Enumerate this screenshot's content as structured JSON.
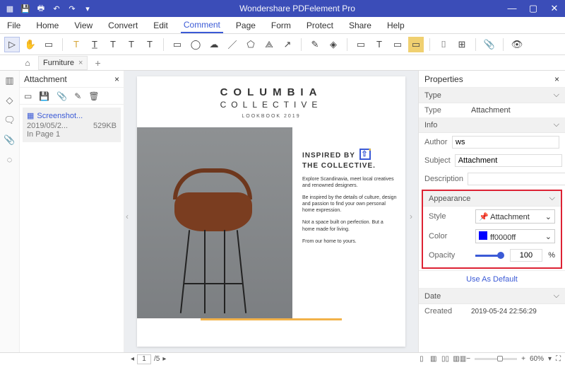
{
  "app": {
    "title": "Wondershare PDFelement Pro"
  },
  "menu": {
    "items": [
      "File",
      "Home",
      "View",
      "Convert",
      "Edit",
      "Comment",
      "Page",
      "Form",
      "Protect",
      "Share",
      "Help"
    ],
    "active": "Comment"
  },
  "tabs": {
    "tab1": "Furniture"
  },
  "attachments": {
    "title": "Attachment",
    "item": {
      "name": "Screenshot...",
      "date": "2019/05/2...",
      "size": "529KB",
      "loc": "In Page 1"
    }
  },
  "doc": {
    "brand1": "COLUMBIA",
    "brand2": "COLLECTIVE",
    "lookbook": "LOOKBOOK 2019",
    "headline1": "INSPIRED BY",
    "headline2": "THE COLLECTIVE.",
    "p1": "Explore Scandinavia, meet local creatives and renowned designers.",
    "p2": "Be inspired by the details of culture, design and passion to find your own personal home expression.",
    "p3": "Not a space built on perfection. But a home made for living.",
    "p4": "From our home to yours."
  },
  "props": {
    "title": "Properties",
    "sec_type": "Type",
    "type_label": "Type",
    "type_value": "Attachment",
    "sec_info": "Info",
    "author_label": "Author",
    "author_value": "ws",
    "subject_label": "Subject",
    "subject_value": "Attachment",
    "desc_label": "Description",
    "desc_value": "",
    "sec_appear": "Appearance",
    "style_label": "Style",
    "style_value": "Attachment",
    "color_label": "Color",
    "color_value": "ff0000ff",
    "opacity_label": "Opacity",
    "opacity_value": "100",
    "opacity_unit": "%",
    "use_default": "Use As Default",
    "sec_date": "Date",
    "created_label": "Created",
    "created_value": "2019-05-24 22:56:29"
  },
  "status": {
    "page_current": "1",
    "page_total": "/5",
    "zoom": "60%"
  }
}
